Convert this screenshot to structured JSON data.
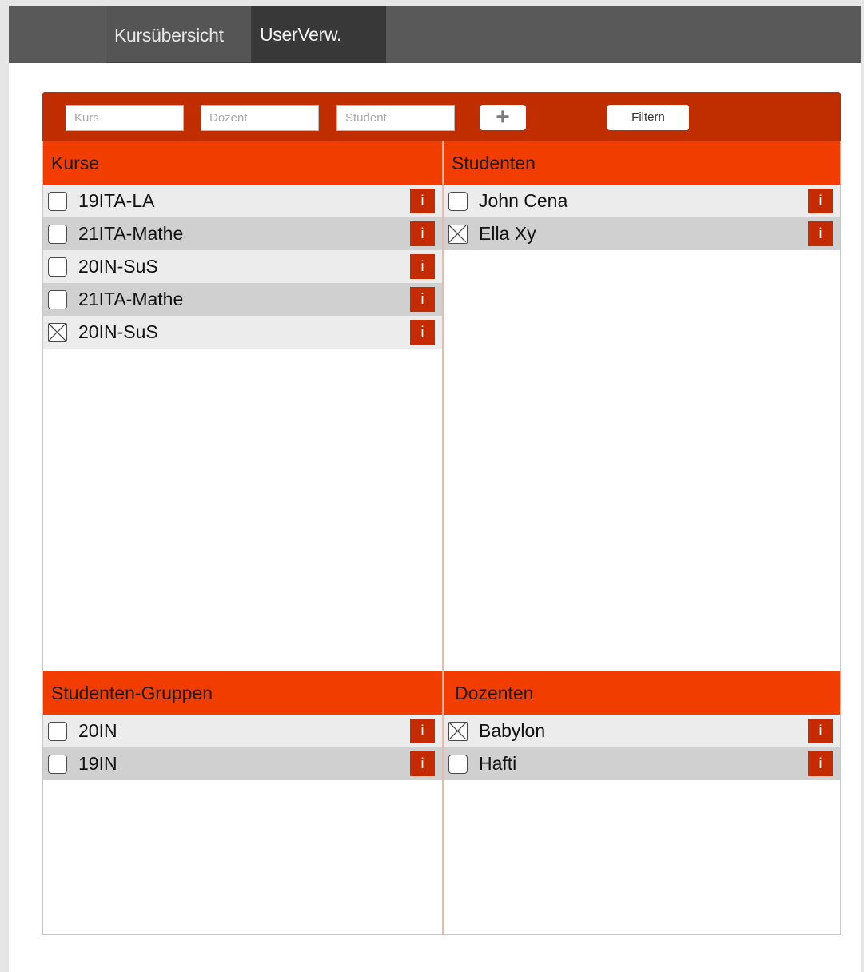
{
  "nav": {
    "tabs": [
      {
        "label": "Kursübersicht",
        "active": true
      },
      {
        "label": "UserVerw.",
        "active": false
      }
    ]
  },
  "filterbar": {
    "kurs_placeholder": "Kurs",
    "dozent_placeholder": "Dozent",
    "student_placeholder": "Student",
    "add_symbol": "+",
    "filter_label": "Filtern"
  },
  "kurse": {
    "title": "Kurse",
    "items": [
      {
        "label": "19ITA-LA",
        "checked": false
      },
      {
        "label": "21ITA-Mathe",
        "checked": false
      },
      {
        "label": "20IN-SuS",
        "checked": false
      },
      {
        "label": "21ITA-Mathe",
        "checked": false
      },
      {
        "label": "20IN-SuS",
        "checked": true
      }
    ]
  },
  "studenten": {
    "title": "Studenten",
    "items": [
      {
        "label": "John Cena",
        "checked": false
      },
      {
        "label": "Ella Xy",
        "checked": true
      }
    ]
  },
  "gruppen": {
    "title": "Studenten-Gruppen",
    "items": [
      {
        "label": "20IN",
        "checked": false
      },
      {
        "label": "19IN",
        "checked": false
      }
    ]
  },
  "dozenten": {
    "title": "Dozenten",
    "items": [
      {
        "label": "Babylon",
        "checked": true
      },
      {
        "label": "Hafti",
        "checked": false
      }
    ]
  },
  "info_symbol": "i",
  "colors": {
    "topbar": "#595959",
    "filterbar": "#c02e00",
    "section_header": "#f23d00",
    "info_button": "#c42b00"
  }
}
